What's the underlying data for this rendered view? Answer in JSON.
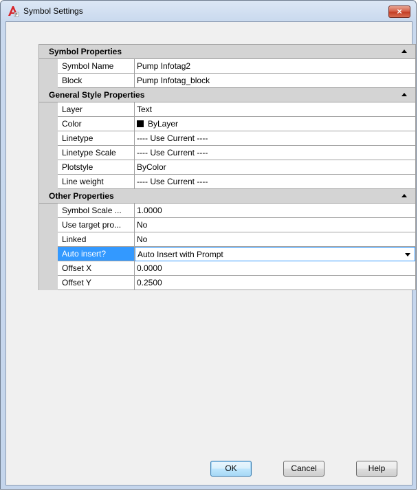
{
  "window": {
    "title": "Symbol Settings",
    "close_label": "×"
  },
  "categories": [
    {
      "label": "Symbol Properties",
      "rows": [
        {
          "name": "Symbol Name",
          "value": "Pump Infotag2"
        },
        {
          "name": "Block",
          "value": "Pump Infotag_block"
        }
      ]
    },
    {
      "label": "General Style Properties",
      "rows": [
        {
          "name": "Layer",
          "value": "Text"
        },
        {
          "name": "Color",
          "value": "ByLayer",
          "swatch": "#000000"
        },
        {
          "name": "Linetype",
          "value": "---- Use Current ----"
        },
        {
          "name": "Linetype Scale",
          "value": "---- Use Current ----"
        },
        {
          "name": "Plotstyle",
          "value": "ByColor"
        },
        {
          "name": "Line weight",
          "value": "---- Use Current ----"
        }
      ]
    },
    {
      "label": "Other Properties",
      "rows": [
        {
          "name": "Symbol Scale ...",
          "value": "1.0000"
        },
        {
          "name": "Use target pro...",
          "value": "No"
        },
        {
          "name": "Linked",
          "value": "No"
        },
        {
          "name": "Auto insert?",
          "value": "Auto Insert with Prompt",
          "selected": true
        },
        {
          "name": "Offset X",
          "value": "0.0000"
        },
        {
          "name": "Offset Y",
          "value": "0.2500"
        }
      ]
    }
  ],
  "buttons": {
    "ok": "OK",
    "cancel": "Cancel",
    "help": "Help"
  },
  "colors": {
    "selection": "#3399ff",
    "category_bg": "#d4d4d4"
  }
}
